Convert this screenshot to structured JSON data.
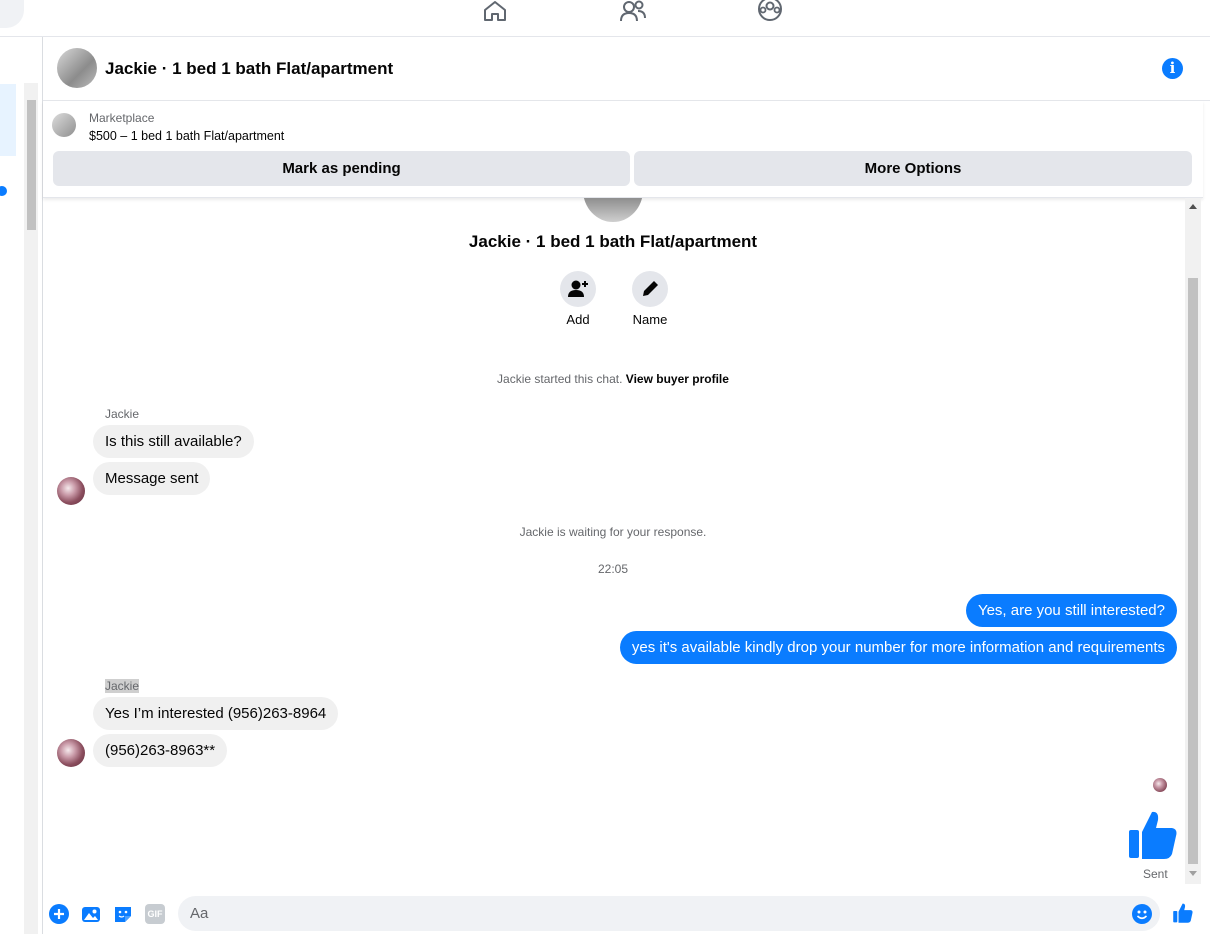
{
  "header": {
    "title": "Jackie · 1 bed 1 bath Flat/apartment"
  },
  "marketplace": {
    "label": "Marketplace",
    "listing": "$500 – 1 bed 1 bath Flat/apartment",
    "mark_pending_label": "Mark as pending",
    "more_options_label": "More Options"
  },
  "chat": {
    "title": "Jackie · 1 bed 1 bath Flat/apartment",
    "add_label": "Add",
    "name_label": "Name",
    "started_text": "Jackie started this chat.",
    "view_profile_label": "View buyer profile",
    "waiting_text": "Jackie is waiting for your response.",
    "timestamp": "22:05",
    "sent_label": "Sent",
    "groups": [
      {
        "sender": "Jackie",
        "messages": [
          "Is this still available?",
          "Message sent"
        ]
      },
      {
        "sender": "Jackie",
        "messages": [
          "Yes I’m interested (956)263-8964",
          "(956)263-8963**"
        ]
      }
    ],
    "outgoing": [
      "Yes, are you still interested?",
      "yes it's available kindly drop your number for more information and requirements"
    ]
  },
  "composer": {
    "placeholder": "Aa",
    "gif_label": "GIF"
  },
  "colors": {
    "accent": "#0a7cff",
    "incoming_bubble": "#f0f0f0",
    "button_gray": "#e4e6eb"
  },
  "icons": {
    "nav": [
      "home-icon",
      "friends-icon",
      "groups-icon"
    ],
    "composer": [
      "plus-icon",
      "image-icon",
      "sticker-icon",
      "gif-icon",
      "emoji-icon",
      "like-icon"
    ]
  }
}
